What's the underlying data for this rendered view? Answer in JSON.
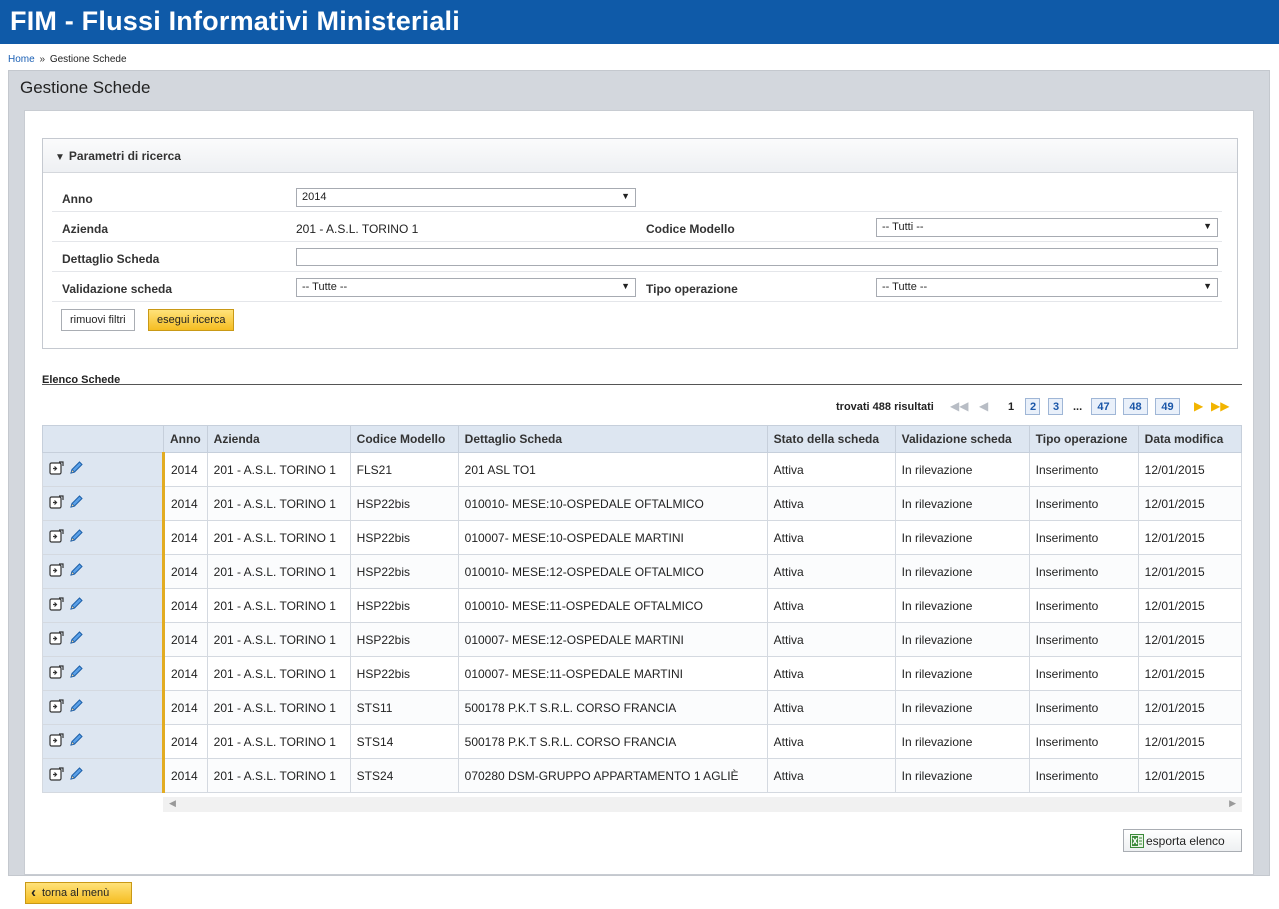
{
  "app": {
    "title": "FIM - Flussi Informativi Ministeriali"
  },
  "breadcrumb": {
    "home": "Home",
    "separator": "»",
    "current": "Gestione Schede"
  },
  "page": {
    "title": "Gestione Schede"
  },
  "search": {
    "header": "Parametri di ricerca",
    "anno": {
      "label": "Anno",
      "value": "2014"
    },
    "azienda": {
      "label": "Azienda",
      "value": "201 - A.S.L. TORINO 1"
    },
    "codice_modello": {
      "label": "Codice Modello",
      "value": "-- Tutti --"
    },
    "dettaglio": {
      "label": "Dettaglio Scheda",
      "value": ""
    },
    "validazione": {
      "label": "Validazione scheda",
      "value": "-- Tutte --"
    },
    "tipo_operazione": {
      "label": "Tipo operazione",
      "value": "-- Tutte --"
    },
    "reset_label": "rimuovi filtri",
    "submit_label": "esegui ricerca"
  },
  "list": {
    "title": "Elenco Schede",
    "pager": {
      "found": "trovati 488 risultati",
      "current": "1",
      "pages": [
        "2",
        "3",
        "47",
        "48",
        "49"
      ],
      "dots": "..."
    },
    "columns": [
      "",
      "Anno",
      "Azienda",
      "Codice Modello",
      "Dettaglio Scheda",
      "Stato della scheda",
      "Validazione scheda",
      "Tipo operazione",
      "Data modifica"
    ],
    "rows": [
      [
        "2014",
        "201 - A.S.L. TORINO 1",
        "FLS21",
        "201 ASL TO1",
        "Attiva",
        "In rilevazione",
        "Inserimento",
        "12/01/2015"
      ],
      [
        "2014",
        "201 - A.S.L. TORINO 1",
        "HSP22bis",
        "010010- MESE:10-OSPEDALE OFTALMICO",
        "Attiva",
        "In rilevazione",
        "Inserimento",
        "12/01/2015"
      ],
      [
        "2014",
        "201 - A.S.L. TORINO 1",
        "HSP22bis",
        "010007- MESE:10-OSPEDALE MARTINI",
        "Attiva",
        "In rilevazione",
        "Inserimento",
        "12/01/2015"
      ],
      [
        "2014",
        "201 - A.S.L. TORINO 1",
        "HSP22bis",
        "010010- MESE:12-OSPEDALE OFTALMICO",
        "Attiva",
        "In rilevazione",
        "Inserimento",
        "12/01/2015"
      ],
      [
        "2014",
        "201 - A.S.L. TORINO 1",
        "HSP22bis",
        "010010- MESE:11-OSPEDALE OFTALMICO",
        "Attiva",
        "In rilevazione",
        "Inserimento",
        "12/01/2015"
      ],
      [
        "2014",
        "201 - A.S.L. TORINO 1",
        "HSP22bis",
        "010007- MESE:12-OSPEDALE MARTINI",
        "Attiva",
        "In rilevazione",
        "Inserimento",
        "12/01/2015"
      ],
      [
        "2014",
        "201 - A.S.L. TORINO 1",
        "HSP22bis",
        "010007- MESE:11-OSPEDALE MARTINI",
        "Attiva",
        "In rilevazione",
        "Inserimento",
        "12/01/2015"
      ],
      [
        "2014",
        "201 - A.S.L. TORINO 1",
        "STS11",
        "500178 P.K.T S.R.L. CORSO FRANCIA",
        "Attiva",
        "In rilevazione",
        "Inserimento",
        "12/01/2015"
      ],
      [
        "2014",
        "201 - A.S.L. TORINO 1",
        "STS14",
        "500178 P.K.T S.R.L. CORSO FRANCIA",
        "Attiva",
        "In rilevazione",
        "Inserimento",
        "12/01/2015"
      ],
      [
        "2014",
        "201 - A.S.L. TORINO 1",
        "STS24",
        "070280 DSM-GRUPPO APPARTAMENTO 1 AGLIÈ",
        "Attiva",
        "In rilevazione",
        "Inserimento",
        "12/01/2015"
      ]
    ],
    "row_icons": [
      "view-icon",
      "edit-pencil-icon"
    ]
  },
  "export_label": "esporta elenco",
  "back_label": "torna al menù",
  "colors": {
    "header": "#0f5aa8",
    "accent": "#f5bd22",
    "table_header": "#dde6f1"
  }
}
